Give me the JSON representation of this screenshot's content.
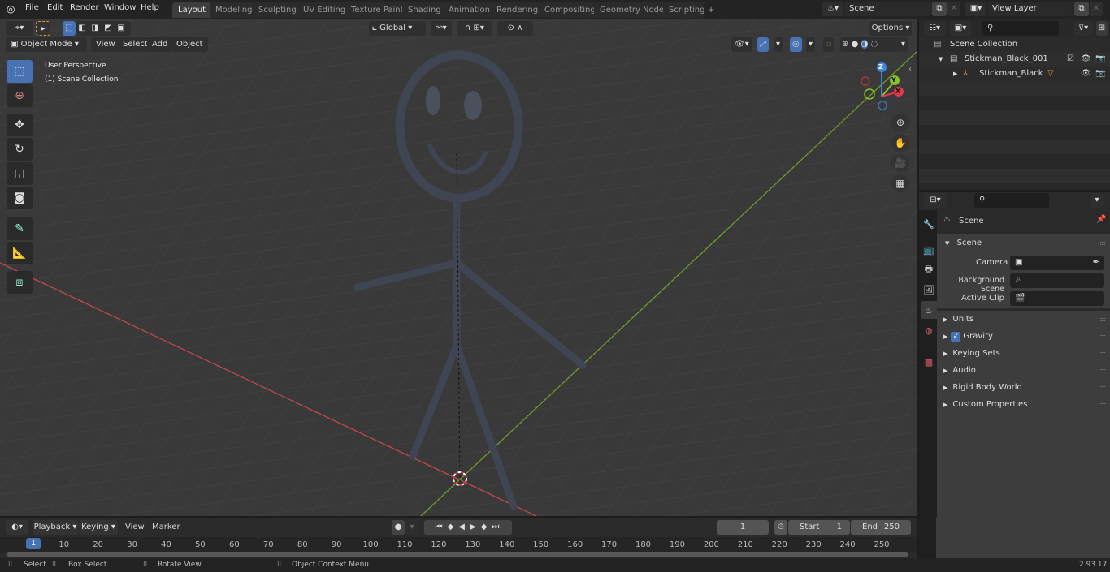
{
  "app": {
    "version": "2.93.17"
  },
  "menu": [
    "File",
    "Edit",
    "Render",
    "Window",
    "Help"
  ],
  "workspaces": [
    "Layout",
    "Modeling",
    "Sculpting",
    "UV Editing",
    "Texture Paint",
    "Shading",
    "Animation",
    "Rendering",
    "Compositing",
    "Geometry Nodes",
    "Scripting"
  ],
  "active_workspace": "Layout",
  "scene_selector": {
    "value": "Scene"
  },
  "view_layer_selector": {
    "value": "View Layer"
  },
  "viewport_header": {
    "mode": "Object Mode",
    "menus": [
      "View",
      "Select",
      "Add",
      "Object"
    ],
    "transform_orientation": "Global",
    "options_label": "Options"
  },
  "viewport": {
    "perspective_label": "User Perspective",
    "collection_label": "(1) Scene Collection",
    "gizmo_axes": [
      "Z",
      "Y",
      "X"
    ],
    "colors": {
      "x_axis": "#e5364f",
      "y_axis": "#8bc02b",
      "z_axis": "#3f86dd",
      "grid_bg": "#3a3a3a",
      "mesh": "#3e4450"
    }
  },
  "toolbar": [
    {
      "name": "select-box",
      "icon": "cursor-box-icon",
      "active": true
    },
    {
      "name": "cursor",
      "icon": "crosshair-icon"
    },
    {
      "name": "move",
      "icon": "move-icon"
    },
    {
      "name": "rotate",
      "icon": "rotate-icon"
    },
    {
      "name": "scale",
      "icon": "scale-icon"
    },
    {
      "name": "transform",
      "icon": "transform-icon"
    },
    {
      "name": "annotate",
      "icon": "pencil-icon"
    },
    {
      "name": "measure",
      "icon": "ruler-icon"
    },
    {
      "name": "add-cube",
      "icon": "cube-add-icon"
    }
  ],
  "outliner": {
    "root": "Scene Collection",
    "items": [
      {
        "label": "Stickman_Black_001",
        "type": "collection"
      },
      {
        "label": "Stickman_Black",
        "type": "armature"
      }
    ]
  },
  "properties": {
    "context_title": "Scene",
    "section_title": "Scene",
    "fields": [
      {
        "label": "Camera",
        "value": ""
      },
      {
        "label": "Background Scene",
        "value": ""
      },
      {
        "label": "Active Clip",
        "value": ""
      }
    ],
    "panels": [
      {
        "label": "Units"
      },
      {
        "label": "Gravity",
        "checkbox": true
      },
      {
        "label": "Keying Sets"
      },
      {
        "label": "Audio"
      },
      {
        "label": "Rigid Body World"
      },
      {
        "label": "Custom Properties"
      }
    ]
  },
  "timeline": {
    "menus": [
      "Playback",
      "Keying",
      "View",
      "Marker"
    ],
    "current_frame": "1",
    "start_label": "Start",
    "start_value": "1",
    "end_label": "End",
    "end_value": "250",
    "ticks": [
      "10",
      "20",
      "30",
      "40",
      "50",
      "60",
      "70",
      "80",
      "90",
      "100",
      "110",
      "120",
      "130",
      "140",
      "150",
      "160",
      "170",
      "180",
      "190",
      "200",
      "210",
      "220",
      "230",
      "240",
      "250"
    ],
    "playhead_label": "1"
  },
  "statusbar": {
    "hints": [
      "Select",
      "Box Select",
      "Rotate View",
      "Object Context Menu"
    ]
  }
}
